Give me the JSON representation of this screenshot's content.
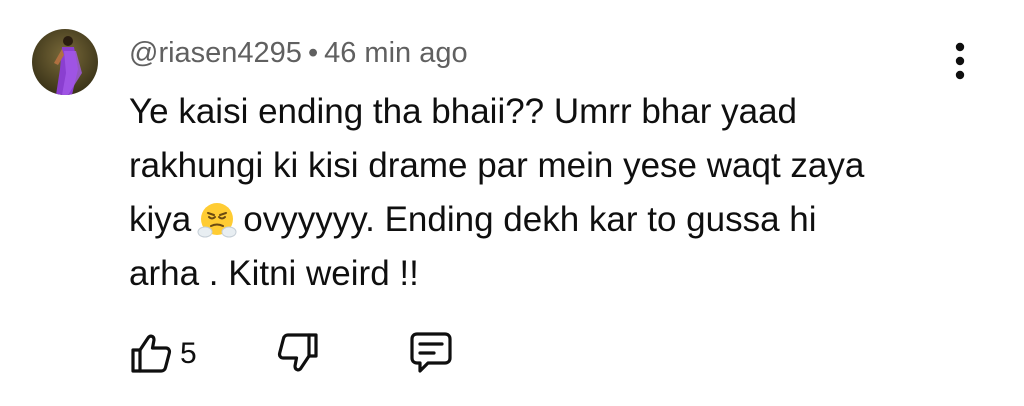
{
  "comment": {
    "author": "@riasen4295",
    "separator": "•",
    "time": "46 min ago",
    "text_lines": [
      "Ye kaisi ending tha bhaii?? Umrr bhar yaad",
      "rakhungi ki kisi drame par mein yese waqt zaya",
      "kiya",
      "ovyyyyy. Ending dekh kar to gussa hi",
      "arha . Kitni weird !!"
    ],
    "emoji": "face-with-steam-from-nose"
  },
  "actions": {
    "like_count": "5",
    "like_icon": "thumbs-up-outline",
    "dislike_icon": "thumbs-down-outline",
    "reply_icon": "comment-bubble-outline",
    "more_icon": "vertical-ellipsis"
  }
}
